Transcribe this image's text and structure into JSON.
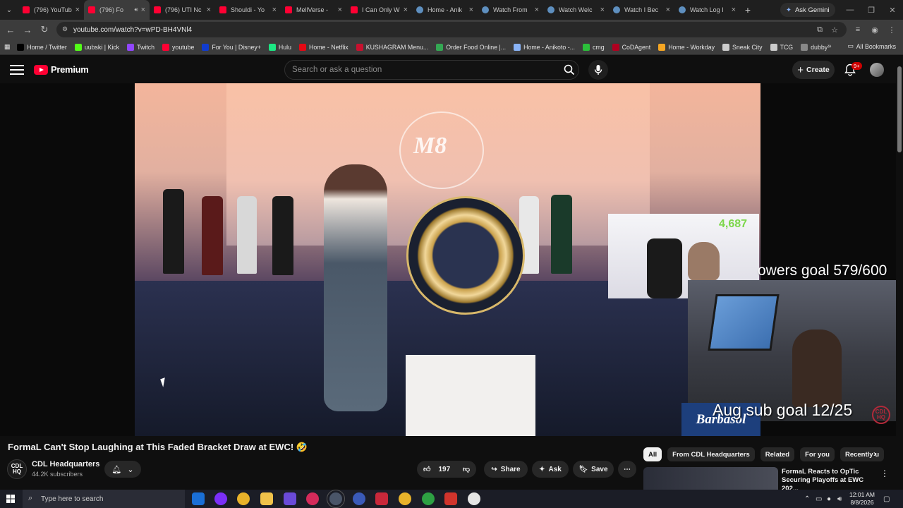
{
  "browser": {
    "tabs": [
      {
        "label": "(796) YouTub",
        "icon": "youtube-icon",
        "active": false
      },
      {
        "label": "(796) Fo",
        "icon": "youtube-icon",
        "active": true
      },
      {
        "label": "(796) UTI Nc",
        "icon": "youtube-icon",
        "active": false
      },
      {
        "label": "Shouldi - Yo",
        "icon": "youtube-icon",
        "active": false
      },
      {
        "label": "MellVerse - ",
        "icon": "youtube-icon",
        "active": false
      },
      {
        "label": "I Can Only W",
        "icon": "youtube-icon",
        "active": false
      },
      {
        "label": "Home - Anik",
        "icon": "globe-icon",
        "active": false
      },
      {
        "label": "Watch From",
        "icon": "globe-icon",
        "active": false
      },
      {
        "label": "Watch Welc",
        "icon": "globe-icon",
        "active": false
      },
      {
        "label": "Watch I Bec",
        "icon": "globe-icon",
        "active": false
      },
      {
        "label": "Watch Log I",
        "icon": "globe-icon",
        "active": false
      }
    ],
    "gemini_label": "Ask Gemini",
    "url": "youtube.com/watch?v=wPD-BH4VNl4",
    "bookmarks": [
      {
        "label": "Home / Twitter",
        "color": "#000000"
      },
      {
        "label": "uubski | Kick",
        "color": "#53fc18"
      },
      {
        "label": "Twitch",
        "color": "#9146ff"
      },
      {
        "label": "youtube",
        "color": "#ff0033"
      },
      {
        "label": "For You | Disney+",
        "color": "#113ccf"
      },
      {
        "label": "Hulu",
        "color": "#1ce783"
      },
      {
        "label": "Home - Netflix",
        "color": "#e50914"
      },
      {
        "label": "KUSHAGRAM Menu...",
        "color": "#c8102e"
      },
      {
        "label": "Order Food Online |...",
        "color": "#34a853"
      },
      {
        "label": "Home - Anikoto -...",
        "color": "#8ab4f8"
      },
      {
        "label": "cmg",
        "color": "#2bbf3a"
      },
      {
        "label": "CoDAgent",
        "color": "#b00020"
      },
      {
        "label": "Home - Workday",
        "color": "#f5a623"
      },
      {
        "label": "Sneak City",
        "color": "#cccccc"
      },
      {
        "label": "TCG",
        "color": "#cccccc"
      },
      {
        "label": "dubby",
        "color": "#888888"
      }
    ],
    "all_bookmarks": "All Bookmarks"
  },
  "youtube": {
    "logo_text": "Premium",
    "search_placeholder": "Search or ask a question",
    "create_label": "Create",
    "notification_count": "9+",
    "overlay": {
      "viewer_count": "4,687",
      "followers_goal": "owers goal 579/600",
      "sub_goal": "Aug sub goal 12/25",
      "sponsor": "Barbasol",
      "channel_badge": "CDL HQ",
      "stage_crest": "M8"
    },
    "video_title": "FormaL Can't Stop Laughing at This Faded Bracket Draw at EWC! 🤣",
    "channel": {
      "avatar_text": "CDL HQ",
      "name": "CDL Headquarters",
      "subscribers": "44.2K subscribers"
    },
    "actions": {
      "likes": "197",
      "share": "Share",
      "ask": "Ask",
      "save": "Save"
    },
    "chips": [
      "All",
      "From CDL Headquarters",
      "Related",
      "For you",
      "Recently u"
    ],
    "recommended": {
      "title": "FormaL Reacts to OpTic Securing Playoffs at EWC 202..."
    }
  },
  "taskbar": {
    "search_placeholder": "Type here to search",
    "time": "12:01 AM",
    "date": "8/8/2026"
  }
}
